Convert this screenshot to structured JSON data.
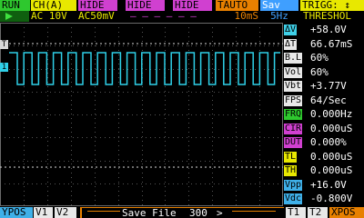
{
  "toolbar": {
    "run": "RUN",
    "channel": "CH(A)",
    "hide1": "HIDE",
    "hide2": "HIDE",
    "hide3": "HIDE",
    "trigger_mode": "TAUTO",
    "save": "Sav",
    "trigger": "TRIGG: ↕"
  },
  "status_line": {
    "coupling": "AC 10V",
    "scale": "AC50mV",
    "dashes": "— — —  — — —",
    "timebase": "10mS",
    "sample_rate": "5Hz",
    "trigger_label": "THRESHOL"
  },
  "measurements": [
    {
      "tag": "ΔV",
      "value": "+58.0V",
      "color": "#3fd0e8"
    },
    {
      "tag": "ΔT",
      "value": "66.67mS",
      "color": "#e8e8e8"
    },
    {
      "tag": "B.L",
      "value": "60%",
      "color": "#e8e8e8"
    },
    {
      "tag": "Vol",
      "value": "60%",
      "color": "#e8e8e8"
    },
    {
      "tag": "Vbt",
      "value": "+3.77V",
      "color": "#e8e8e8"
    },
    {
      "tag": "FPS",
      "value": "64/Sec",
      "color": "#000000"
    },
    {
      "tag": "FRQ",
      "value": "0.000Hz",
      "color": "#2ec82e"
    },
    {
      "tag": "CIR",
      "value": "0.000uS",
      "color": "#d040d0"
    },
    {
      "tag": "DUT",
      "value": "0.000%",
      "color": "#d040d0"
    },
    {
      "tag": "TL",
      "value": "0.000uS",
      "color": "#e8e800"
    },
    {
      "tag": "TH",
      "value": "0.000uS",
      "color": "#e8e800"
    },
    {
      "tag": "Vpp",
      "value": "+16.0V",
      "color": "#3fb0e8"
    },
    {
      "tag": "Vdc",
      "value": "-0.800V",
      "color": "#3fb0e8"
    }
  ],
  "bottom_bar": {
    "ypos": "YPOS",
    "v1": "V1",
    "v2": "V2",
    "save_file": "Save File",
    "file_number": "300",
    "arrow": ">",
    "t1": "T1",
    "t2": "T2",
    "xpos": "XPOS"
  },
  "markers": {
    "trigger_marker": "T",
    "channel_marker": "1"
  },
  "colors": {
    "trace": "#2fd0e8",
    "grid": "#555555",
    "run": "#2ec82e",
    "channel": "#e8e800",
    "hide": "#d040d0",
    "trigger_mode": "#e88000",
    "save": "#3f9fff",
    "trigger": "#e8e800",
    "threshold_line": "#d8d8d8"
  }
}
